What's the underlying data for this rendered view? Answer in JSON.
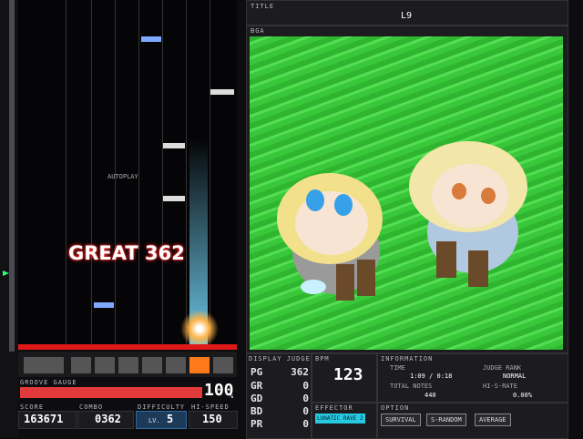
{
  "playfield": {
    "autoplay_label": "AUTOPLAY",
    "judge_text": "GREAT 362",
    "gauge_label": "GROOVE GAUGE",
    "gauge_percent": 100,
    "gauge_display": "100",
    "gauge_unit": "%"
  },
  "stats": {
    "score_label": "SCORE",
    "score": "163671",
    "combo_label": "COMBO",
    "combo": "0362",
    "difficulty_label": "DIFFICULTY",
    "level_prefix": "LV.",
    "level": "5",
    "hispeed_label": "HI-SPEED",
    "hispeed": "150"
  },
  "title_panel": {
    "label": "TITLE",
    "title": "L9"
  },
  "bga_panel": {
    "label": "BGA"
  },
  "judge_panel": {
    "label": "DISPLAY JUDGE",
    "rows": [
      {
        "k": "PG",
        "v": "362"
      },
      {
        "k": "GR",
        "v": "0"
      },
      {
        "k": "GD",
        "v": "0"
      },
      {
        "k": "BD",
        "v": "0"
      },
      {
        "k": "PR",
        "v": "0"
      }
    ]
  },
  "bpm_panel": {
    "label": "BPM",
    "value": "123"
  },
  "info_panel": {
    "label": "INFORMATION",
    "time_label": "TIME",
    "time": "1:09 / 0:18",
    "notes_label": "TOTAL NOTES",
    "notes": "440",
    "rank_label": "JUDGE RANK",
    "rank": "NORMAL",
    "hirate_label": "HI-S-RATE",
    "hirate": "0.00%"
  },
  "effector_panel": {
    "label": "EFFECTOR",
    "value": "LUNATIC RAVE 2"
  },
  "option_panel": {
    "label": "OPTION",
    "options": [
      "SURVIVAL",
      "S-RANDOM",
      "AVERAGE"
    ]
  },
  "colors": {
    "gauge": "#e23a3a",
    "scratch_accent": "#27c9e0",
    "bga_grass": "#3ec83e"
  }
}
